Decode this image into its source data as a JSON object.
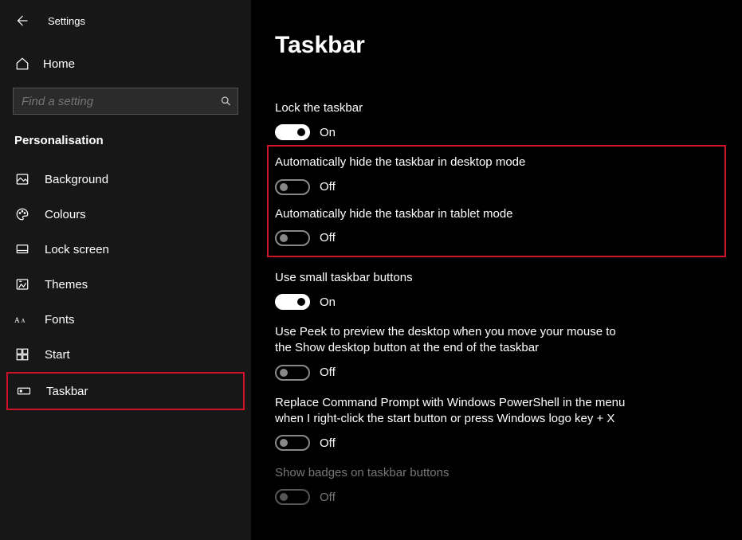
{
  "appTitle": "Settings",
  "home": "Home",
  "searchPlaceholder": "Find a setting",
  "sectionTitle": "Personalisation",
  "nav": {
    "background": "Background",
    "colours": "Colours",
    "lockscreen": "Lock screen",
    "themes": "Themes",
    "fonts": "Fonts",
    "start": "Start",
    "taskbar": "Taskbar"
  },
  "pageHeader": "Taskbar",
  "labels": {
    "lock": "Lock the taskbar",
    "hideDesktop": "Automatically hide the taskbar in desktop mode",
    "hideTablet": "Automatically hide the taskbar in tablet mode",
    "smallButtons": "Use small taskbar buttons",
    "peek": "Use Peek to preview the desktop when you move your mouse to the Show desktop button at the end of the taskbar",
    "powershell": "Replace Command Prompt with Windows PowerShell in the menu when I right-click the start button or press Windows logo key + X",
    "badges": "Show badges on taskbar buttons"
  },
  "states": {
    "on": "On",
    "off": "Off"
  }
}
